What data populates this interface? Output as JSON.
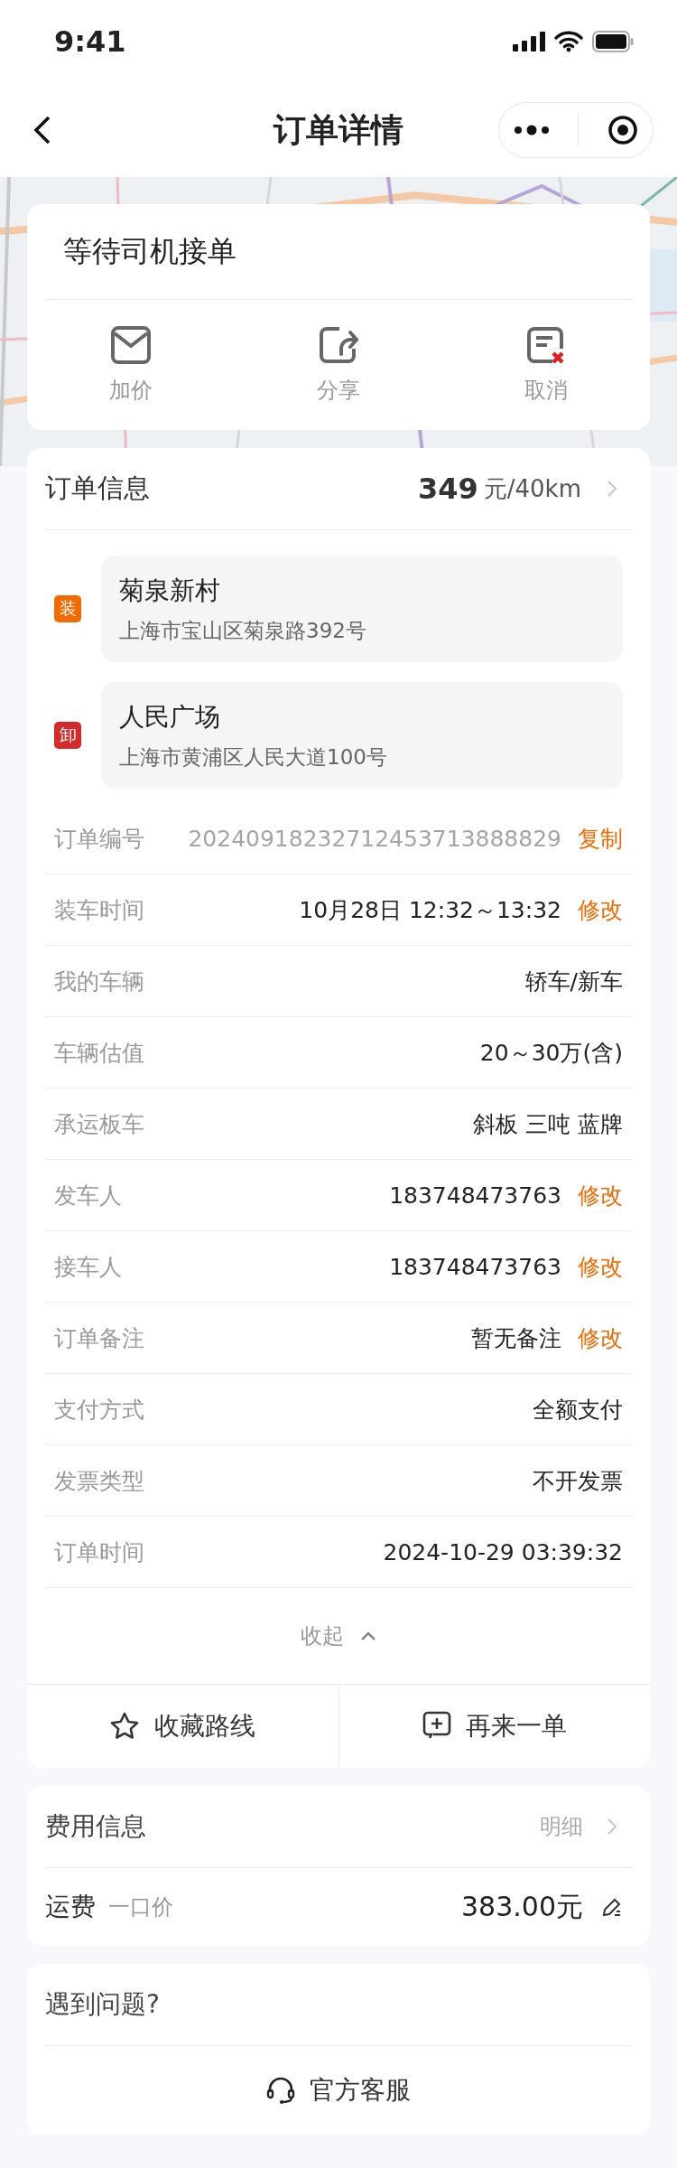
{
  "status_bar": {
    "time": "9:41"
  },
  "nav": {
    "title": "订单详情"
  },
  "status_card": {
    "title": "等待司机接单",
    "actions": [
      {
        "label": "加价",
        "kind": "mail"
      },
      {
        "label": "分享",
        "kind": "share"
      },
      {
        "label": "取消",
        "kind": "cancel"
      }
    ]
  },
  "order": {
    "title": "订单信息",
    "price": "349",
    "price_unit": "元/40km",
    "stops": [
      {
        "tag": "装",
        "color": "#f56a00",
        "name": "菊泉新村",
        "address": "上海市宝山区菊泉路392号"
      },
      {
        "tag": "卸",
        "color": "#d42a2a",
        "name": "人民广场",
        "address": "上海市黄浦区人民大道100号"
      }
    ],
    "rows": [
      {
        "label": "订单编号",
        "value": "20240918232712453713888829",
        "muted": true,
        "action": "复制"
      },
      {
        "label": "装车时间",
        "value": "10月28日 12:32～13:32",
        "muted": false,
        "action": "修改"
      },
      {
        "label": "我的车辆",
        "value": "轿车/新车",
        "muted": false
      },
      {
        "label": "车辆估值",
        "value": "20～30万(含)",
        "muted": false
      },
      {
        "label": "承运板车",
        "value": "斜板 三吨 蓝牌",
        "muted": false
      },
      {
        "label": "发车人",
        "value": "183748473763",
        "muted": false,
        "action": "修改"
      },
      {
        "label": "接车人",
        "value": "183748473763",
        "muted": false,
        "action": "修改"
      },
      {
        "label": "订单备注",
        "value": "暂无备注",
        "muted": false,
        "action": "修改"
      },
      {
        "label": "支付方式",
        "value": "全额支付",
        "muted": false
      },
      {
        "label": "发票类型",
        "value": "不开发票",
        "muted": false
      },
      {
        "label": "订单时间",
        "value": "2024-10-29 03:39:32",
        "muted": false
      }
    ],
    "collapse": "收起",
    "buttons": [
      {
        "label": "收藏路线",
        "kind": "star"
      },
      {
        "label": "再来一单",
        "kind": "add"
      }
    ]
  },
  "fees": {
    "title": "费用信息",
    "detail": "明细",
    "item": {
      "label": "运费",
      "note": "一口价",
      "value": "383.00元"
    }
  },
  "help": {
    "title": "遇到问题?",
    "button": "官方客服"
  }
}
